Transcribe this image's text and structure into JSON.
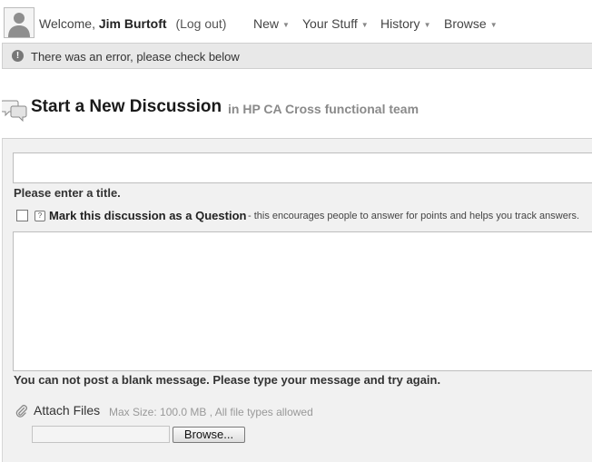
{
  "header": {
    "welcome_prefix": "Welcome,",
    "user_name": "Jim Burtoft",
    "logout_label": "(Log out)",
    "nav": [
      {
        "label": "New"
      },
      {
        "label": "Your Stuff"
      },
      {
        "label": "History"
      },
      {
        "label": "Browse"
      }
    ]
  },
  "error_bar": {
    "icon": "exclamation-icon",
    "message": "There was an error, please check below"
  },
  "page": {
    "title": "Start a New Discussion",
    "in_group": "in HP CA Cross functional team",
    "title_icon": "discussion-bubbles-icon"
  },
  "form": {
    "title_value": "",
    "title_error": "Please enter a title.",
    "question_label": "Mark this discussion as a Question",
    "question_hint": "- this encourages people to answer for points and helps you track answers.",
    "question_checked": false,
    "body_value": "",
    "body_error": "You can not post a blank message. Please type your message and try again.",
    "attach_label": "Attach Files",
    "attach_note": "Max Size: 100.0 MB , All file types allowed",
    "browse_label": "Browse..."
  },
  "colors": {
    "error_bar_bg": "#e8e8e8",
    "panel_bg": "#f1f1f1",
    "group_text": "#8a8a8a"
  }
}
